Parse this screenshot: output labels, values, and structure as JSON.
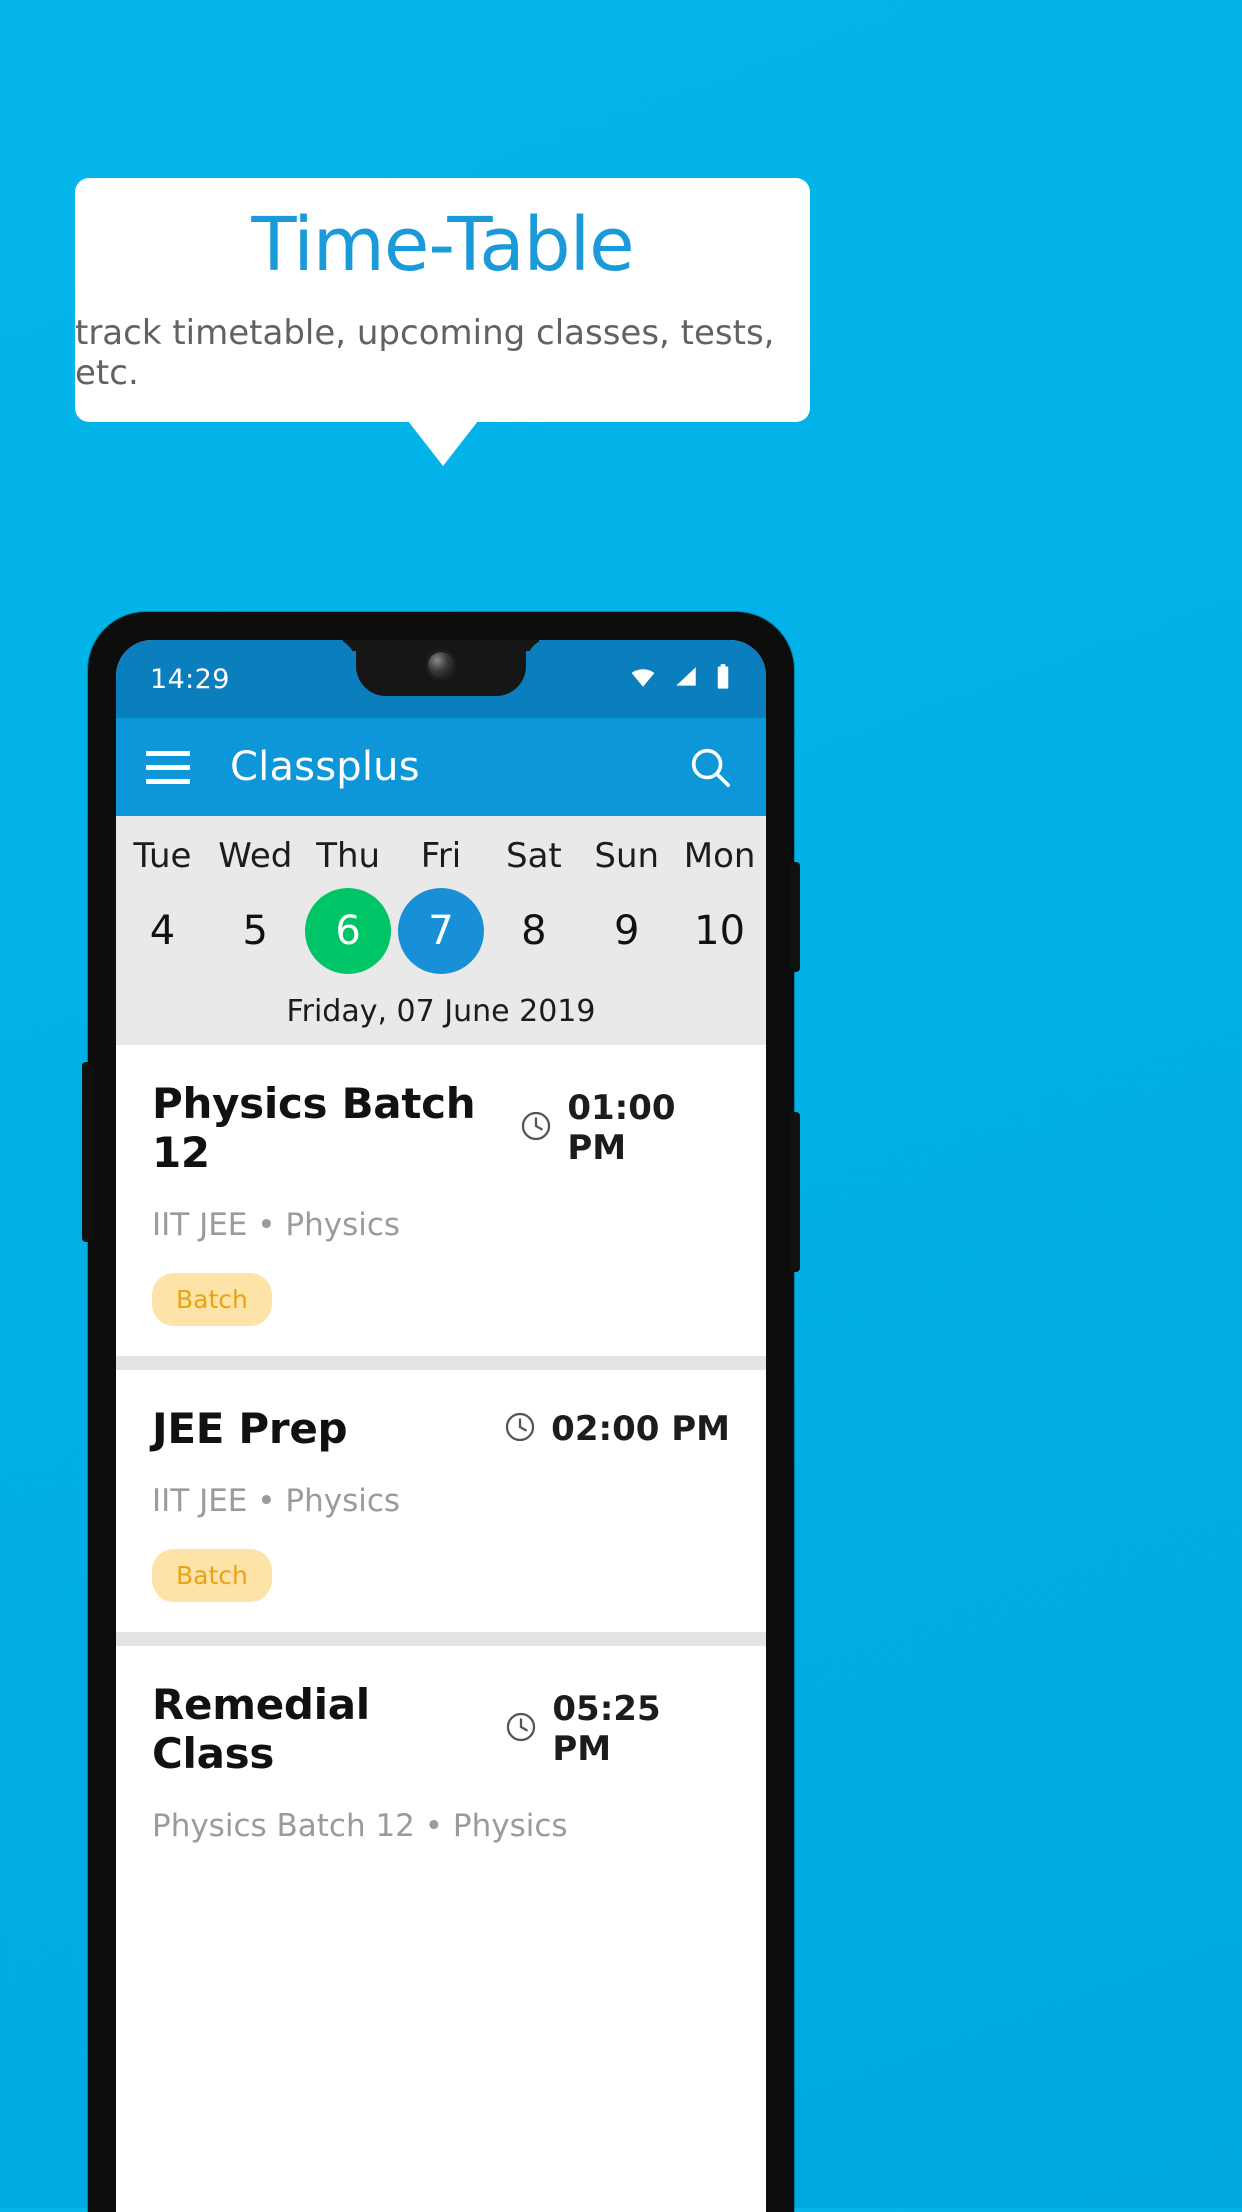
{
  "promo": {
    "title": "Time-Table",
    "subtitle": "track timetable, upcoming classes, tests, etc.",
    "title_color": "#1a9ad8",
    "background_color": "#00b4e6"
  },
  "phone": {
    "statusbar": {
      "time": "14:29",
      "icons": [
        "wifi-icon",
        "signal-icon",
        "battery-icon"
      ]
    },
    "appbar": {
      "menu_icon": "hamburger-icon",
      "title": "Classplus",
      "search_icon": "search-icon"
    },
    "calendar": {
      "days": [
        {
          "dow": "Tue",
          "num": "4",
          "state": ""
        },
        {
          "dow": "Wed",
          "num": "5",
          "state": ""
        },
        {
          "dow": "Thu",
          "num": "6",
          "state": "today"
        },
        {
          "dow": "Fri",
          "num": "7",
          "state": "selected"
        },
        {
          "dow": "Sat",
          "num": "8",
          "state": ""
        },
        {
          "dow": "Sun",
          "num": "9",
          "state": ""
        },
        {
          "dow": "Mon",
          "num": "10",
          "state": ""
        }
      ],
      "full_date": "Friday, 07 June 2019",
      "today_color": "#00c566",
      "selected_color": "#1890d8"
    },
    "classes": [
      {
        "title": "Physics Batch 12",
        "time": "01:00 PM",
        "subtitle": "IIT JEE • Physics",
        "chip": "Batch",
        "clock_icon": "clock-icon"
      },
      {
        "title": "JEE Prep",
        "time": "02:00 PM",
        "subtitle": "IIT JEE • Physics",
        "chip": "Batch",
        "clock_icon": "clock-icon"
      },
      {
        "title": "Remedial Class",
        "time": "05:25 PM",
        "subtitle": "Physics Batch 12 • Physics",
        "chip": "",
        "clock_icon": "clock-icon"
      }
    ],
    "chip_colors": {
      "background": "#fde3a7",
      "text": "#e8a317"
    }
  }
}
